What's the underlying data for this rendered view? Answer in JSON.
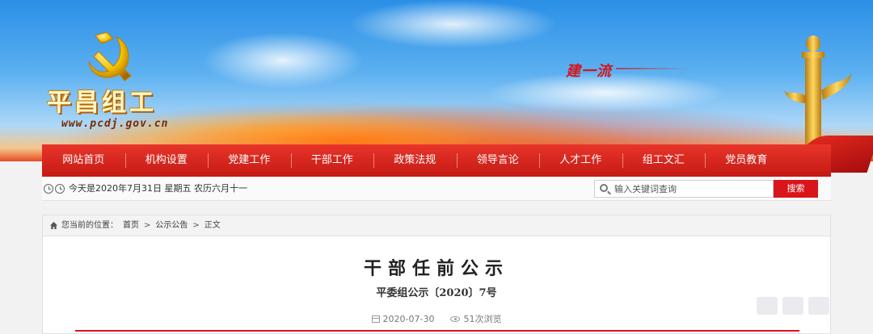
{
  "header": {
    "site_title": "平昌组工",
    "site_url": "www.pcdj.gov.cn",
    "slogan": "建一流"
  },
  "nav": {
    "items": [
      {
        "label": "网站首页"
      },
      {
        "label": "机构设置"
      },
      {
        "label": "党建工作"
      },
      {
        "label": "干部工作"
      },
      {
        "label": "政策法规"
      },
      {
        "label": "领导言论"
      },
      {
        "label": "人才工作"
      },
      {
        "label": "组工文汇"
      },
      {
        "label": "党员教育"
      }
    ]
  },
  "infobar": {
    "date_text": "今天是2020年7月31日 星期五 农历六月十一",
    "search_placeholder": "输入关键词查询",
    "search_button": "搜索"
  },
  "breadcrumb": {
    "prefix": "您当前的位置：",
    "items": [
      "首页",
      "公示公告",
      "正文"
    ],
    "separator": ">"
  },
  "article": {
    "title": "干部任前公示",
    "doc_number": "平委组公示〔2020〕7号",
    "date": "2020-07-30",
    "views": "51次浏览"
  },
  "colors": {
    "nav_red": "#d9141a",
    "accent_gold": "#f5c200"
  }
}
